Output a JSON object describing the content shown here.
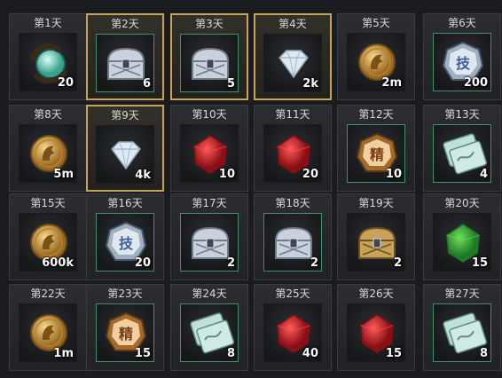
{
  "items": [
    {
      "day": "第1天",
      "qty": "20",
      "icon": "dragon-orb-icon",
      "frame": "plain",
      "border": "none"
    },
    {
      "day": "第2天",
      "qty": "6",
      "icon": "silver-chest-icon",
      "frame": "gold",
      "border": "green"
    },
    {
      "day": "第3天",
      "qty": "5",
      "icon": "silver-chest-icon",
      "frame": "gold",
      "border": "green"
    },
    {
      "day": "第4天",
      "qty": "2k",
      "icon": "diamond-icon",
      "frame": "gold",
      "border": "none"
    },
    {
      "day": "第5天",
      "qty": "2m",
      "icon": "gold-coin-icon",
      "frame": "plain",
      "border": "none"
    },
    {
      "day": "第6天",
      "qty": "200",
      "icon": "skill-badge-icon",
      "frame": "plain",
      "border": "green"
    },
    {
      "day": "第8天",
      "qty": "5m",
      "icon": "gold-coin-icon",
      "frame": "plain",
      "border": "none"
    },
    {
      "day": "第9天",
      "qty": "4k",
      "icon": "diamond-icon",
      "frame": "gold",
      "border": "none"
    },
    {
      "day": "第10天",
      "qty": "10",
      "icon": "red-gem-icon",
      "frame": "plain",
      "border": "none"
    },
    {
      "day": "第11天",
      "qty": "20",
      "icon": "red-gem-icon",
      "frame": "plain",
      "border": "none"
    },
    {
      "day": "第12天",
      "qty": "10",
      "icon": "refine-medal-icon",
      "frame": "plain",
      "border": "green"
    },
    {
      "day": "第13天",
      "qty": "4",
      "icon": "ticket-icon",
      "frame": "plain",
      "border": "green"
    },
    {
      "day": "第15天",
      "qty": "600k",
      "icon": "gold-coin-icon",
      "frame": "plain",
      "border": "none"
    },
    {
      "day": "第16天",
      "qty": "20",
      "icon": "skill-badge-icon",
      "frame": "plain",
      "border": "green"
    },
    {
      "day": "第17天",
      "qty": "2",
      "icon": "silver-chest-icon",
      "frame": "plain",
      "border": "green"
    },
    {
      "day": "第18天",
      "qty": "2",
      "icon": "silver-chest-icon",
      "frame": "plain",
      "border": "green"
    },
    {
      "day": "第19天",
      "qty": "2",
      "icon": "gold-chest-icon",
      "frame": "plain",
      "border": "none"
    },
    {
      "day": "第20天",
      "qty": "15",
      "icon": "green-gem-icon",
      "frame": "plain",
      "border": "none"
    },
    {
      "day": "第22天",
      "qty": "1m",
      "icon": "gold-coin-icon",
      "frame": "plain",
      "border": "none"
    },
    {
      "day": "第23天",
      "qty": "15",
      "icon": "refine-medal-icon",
      "frame": "plain",
      "border": "green"
    },
    {
      "day": "第24天",
      "qty": "8",
      "icon": "ticket-icon",
      "frame": "plain",
      "border": "green"
    },
    {
      "day": "第25天",
      "qty": "40",
      "icon": "red-gem-icon",
      "frame": "plain",
      "border": "none"
    },
    {
      "day": "第26天",
      "qty": "15",
      "icon": "red-gem-icon",
      "frame": "plain",
      "border": "none"
    },
    {
      "day": "第27天",
      "qty": "8",
      "icon": "ticket-icon",
      "frame": "plain",
      "border": "green"
    }
  ],
  "colors": {
    "gold_frame": "#c8a45a",
    "green_border": "#3f8f6d",
    "background": "#1a1c1f"
  }
}
